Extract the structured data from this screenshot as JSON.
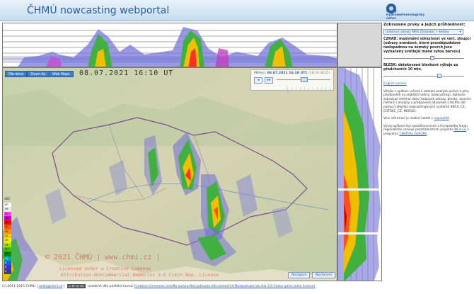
{
  "header": {
    "title": "ČHMÚ nowcasting webportal",
    "logo_lines": [
      "Český",
      "hydrometeorologický",
      "ústav"
    ]
  },
  "map": {
    "tabs": [
      {
        "label": "Dle okna"
      },
      {
        "label": "Zoom Ao"
      },
      {
        "label": "Web Maps"
      }
    ],
    "timestamp": "08.07.2021 16:10 UT",
    "player": {
      "prefix": "Měření:",
      "time": "08.07.2021 16:10 UTC",
      "selected": "(18:10 SELČ)",
      "prev_label": "◂",
      "play_label": "▸▸",
      "ticks": "| | | | | | | | | | | |"
    },
    "legend": {
      "unit": "dBZ",
      "values": [
        "60",
        "56",
        "52",
        "48",
        "44",
        "40",
        "36",
        "32",
        "28",
        "24",
        "20",
        "16",
        "12",
        "8",
        "4",
        "0"
      ],
      "colors": [
        "#ffffff",
        "#e8e8e8",
        "#ff40ff",
        "#d000d0",
        "#ff0000",
        "#ff5a00",
        "#ff9600",
        "#ffc800",
        "#f0f000",
        "#a8e000",
        "#40c000",
        "#008c00",
        "#00a8a8",
        "#0064ff",
        "#3838d0",
        "#3838a0"
      ]
    },
    "watermark": {
      "line1": "© 2021 ČHMÚ | www.chmi.cz |",
      "line2": "Licensed under a Creative Commons",
      "line3": "Attribution-NonCommercial-NoDerivs 3.0 Czech Rep. License"
    },
    "buttons": {
      "navigate": "Navigace",
      "settings": "Nastavení"
    }
  },
  "side": {
    "title": "Zobrazené prvky a jejich průhlednost:",
    "layer_select": "radarové odrazy MAX Z(maska) + blesky",
    "czrad_heading": "CZRAD: maximální odrazivost ve vert. sloupci (odrazy oranžově, které pravděpodobně nedopadnou na zemský povrch jsou vyznačeny světlejší méně sytou barvou)",
    "blesk_heading": "BLESK: detekované bleskové výboje za předchozích 10 min.",
    "english_link": "English version",
    "intro": "Vítejte v aplikaci určené k detailní analýze počasí a jeho předpovědi na nejbližší hodiny (nowcasting). Aplikace zobrazuje měřená data (radarové odrazy, blesky, staniční měření) i analýzy a předpovědi odvozené z těchto dat pomocí několika nowcastingových systémů (INCA_CZ, COTREC_CZ, MERGE).",
    "more_info_text": "Více informací je možné nalézt v",
    "more_info_link": "nápovědě",
    "funding": "Vývoj aplikace byl spolufinancován z Evropského fondu regionálního rozvoje prostřednictvím projektu",
    "funding_link1": "INCA-CE",
    "funding_mid": "v programu",
    "funding_link2": "CENTRAL EUROPE"
  },
  "footer": {
    "copyright": "(c) 2011-2015 ČHMÚ |",
    "email": "radar@chmi.cz",
    "cc_badge": "cc BY NC ND",
    "license_text": "uvedené dílo podléhá licenci",
    "license_link": "Creative Commons Uveďte autora-Nevyužívejte dílo komerčně-Nezasahujte do díla 3.0 Česko (plné znění licence)"
  }
}
